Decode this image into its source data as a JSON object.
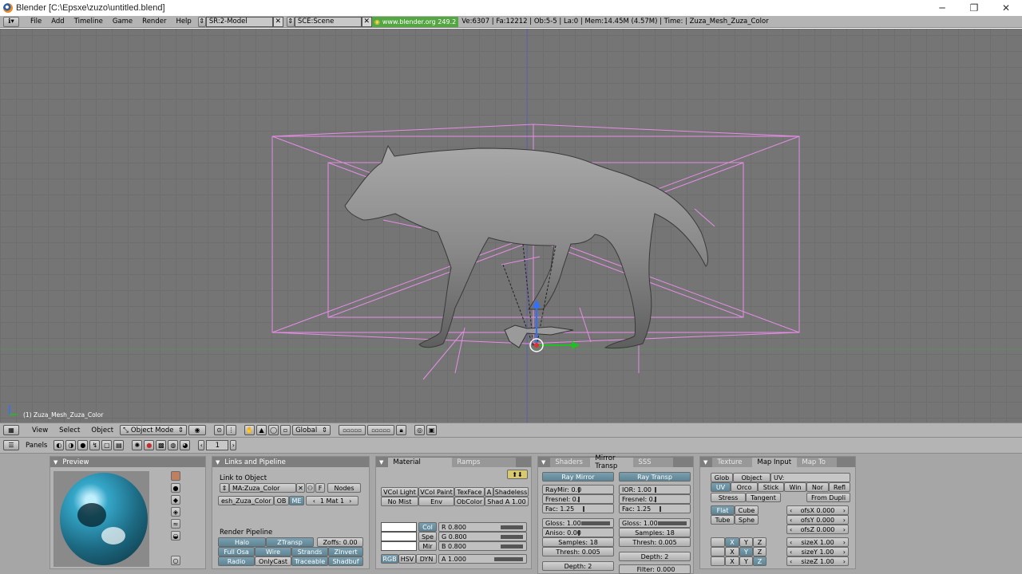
{
  "window": {
    "title": "Blender [C:\\Epsxe\\zuzo\\untitled.blend]",
    "controls": {
      "minimize": "─",
      "maximize": "❐",
      "close": "✕"
    }
  },
  "info_header": {
    "menu": [
      "File",
      "Add",
      "Timeline",
      "Game",
      "Render",
      "Help"
    ],
    "screen": "SR:2-Model",
    "scene": "SCE:Scene",
    "url": "www.blender.org 249.2",
    "stats": "Ve:6307 | Fa:12212 | Ob:5-5 | La:0  | Mem:14.45M (4.57M)  | Time: | Zuza_Mesh_Zuza_Color"
  },
  "viewport": {
    "object_label": "(1) Zuza_Mesh_Zuza_Color"
  },
  "viewport_header": {
    "menu": [
      "View",
      "Select",
      "Object"
    ],
    "mode": "Object Mode",
    "orientation": "Global"
  },
  "buttons_header": {
    "panels_label": "Panels",
    "frame": "1"
  },
  "preview_panel": {
    "title": "Preview"
  },
  "links_panel": {
    "title": "Links and Pipeline",
    "link_to_object": "Link to Object",
    "material_name": "MA:Zuza_Color",
    "f_btn": "F",
    "nodes_btn": "Nodes",
    "mesh_name": "esh_Zuza_Color",
    "ob_btn": "OB",
    "me_btn": "ME",
    "mat_index": "1 Mat 1",
    "render_pipeline": "Render Pipeline",
    "buttons": [
      "Halo",
      "ZTransp",
      "Zoffs: 0.00",
      "Full Osa",
      "Wire",
      "Strands",
      "ZInvert",
      "Radio",
      "OnlyCast",
      "Traceable",
      "Shadbuf"
    ]
  },
  "material_panel": {
    "tabs": [
      "Material",
      "Ramps"
    ],
    "row1": [
      "VCol Light",
      "VCol Paint",
      "TexFace",
      "A",
      "Shadeless"
    ],
    "row2": [
      "No Mist",
      "Env",
      "ObColor",
      "Shad A 1.00"
    ],
    "color_tabs": [
      "Col",
      "Spe",
      "Mir"
    ],
    "rgb": [
      "R 0.800",
      "G 0.800",
      "B 0.800"
    ],
    "modes": [
      "RGB",
      "HSV",
      "DYN"
    ],
    "alpha": "A 1.000"
  },
  "shaders_panel": {
    "tabs": [
      "Shaders",
      "Mirror Transp",
      "SSS"
    ],
    "ray_mirror": "Ray Mirror",
    "ray_transp": "Ray Transp",
    "left": [
      "RayMir: 0.0",
      "Fresnel: 0.",
      "Fac: 1.25",
      "Gloss: 1.00",
      "Aniso: 0.00",
      "Samples: 18",
      "Thresh: 0.005",
      "Depth: 2"
    ],
    "right": [
      "IOR: 1.00",
      "Fresnel: 0.",
      "Fac: 1.25",
      "Gloss: 1.00",
      "Samples: 18",
      "Thresh: 0.005",
      "Depth: 2",
      "Filter: 0.000"
    ]
  },
  "texture_panel": {
    "tabs": [
      "Texture",
      "Map Input",
      "Map To"
    ],
    "row1": [
      "Glob",
      "Object",
      "UV:"
    ],
    "row2": [
      "UV",
      "Orco",
      "Stick",
      "Win",
      "Nor",
      "Refl"
    ],
    "row3": [
      "Stress",
      "Tangent",
      "From Dupli"
    ],
    "proj": [
      "Flat",
      "Cube",
      "Tube",
      "Sphe"
    ],
    "ofs": [
      "ofsX 0.000",
      "ofsY 0.000",
      "ofsZ 0.000"
    ],
    "size": [
      "sizeX 1.00",
      "sizeY 1.00",
      "sizeZ 1.00"
    ],
    "axes": [
      "X",
      "Y",
      "Z"
    ]
  },
  "colors": {
    "viewport_bg": "#757575",
    "wire": "#e88ae8",
    "active_btn": "#6e95a5",
    "url_green": "#54a642"
  }
}
